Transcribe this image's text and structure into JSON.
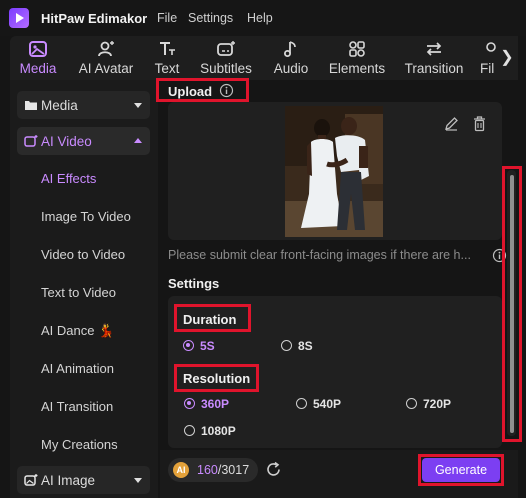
{
  "app": {
    "name": "HitPaw Edimakor",
    "menus": [
      "File",
      "Settings",
      "Help"
    ]
  },
  "toolbar": {
    "tabs": [
      {
        "label": "Media",
        "icon": "media-icon",
        "active": true
      },
      {
        "label": "AI Avatar",
        "icon": "ai-avatar-icon",
        "active": false
      },
      {
        "label": "Text",
        "icon": "text-icon",
        "active": false
      },
      {
        "label": "Subtitles",
        "icon": "subtitles-icon",
        "active": false
      },
      {
        "label": "Audio",
        "icon": "audio-icon",
        "active": false
      },
      {
        "label": "Elements",
        "icon": "elements-icon",
        "active": false
      },
      {
        "label": "Transition",
        "icon": "transition-icon",
        "active": false
      },
      {
        "label": "Fil",
        "icon": "filter-icon",
        "active": false
      }
    ],
    "next_icon": "chevron-right-icon"
  },
  "sidebar": {
    "groups": [
      {
        "label": "Media",
        "icon": "folder-icon",
        "expanded": false
      },
      {
        "label": "AI Video",
        "icon": "ai-video-icon",
        "expanded": true
      },
      {
        "label": "AI Image",
        "icon": "ai-image-icon",
        "expanded": false
      }
    ],
    "ai_video_items": [
      {
        "label": "AI Effects",
        "active": true
      },
      {
        "label": "Image To Video",
        "active": false
      },
      {
        "label": "Video to Video",
        "active": false
      },
      {
        "label": "Text to Video",
        "active": false
      },
      {
        "label": "AI Dance 💃",
        "active": false
      },
      {
        "label": "AI Animation",
        "active": false
      },
      {
        "label": "AI Transition",
        "active": false
      },
      {
        "label": "My Creations",
        "active": false
      }
    ]
  },
  "upload": {
    "title": "Upload",
    "info_icon": "info-icon",
    "edit_icon": "edit-icon",
    "delete_icon": "trash-icon",
    "hint": "Please submit clear front-facing images if there are h..."
  },
  "settings": {
    "title": "Settings",
    "duration": {
      "label": "Duration",
      "options": [
        "5S",
        "8S"
      ],
      "selected": "5S"
    },
    "resolution": {
      "label": "Resolution",
      "options": [
        "360P",
        "540P",
        "720P",
        "1080P"
      ],
      "selected": "360P"
    }
  },
  "footer": {
    "coin_icon": "ai-credit-icon",
    "coin_glyph": "AI",
    "credits_used": "160",
    "credits_total": "/3017",
    "refresh_icon": "refresh-icon",
    "generate_label": "Generate"
  },
  "colors": {
    "accent": "#c98bff",
    "button": "#7c3ff2",
    "highlight": "#e0142c"
  }
}
